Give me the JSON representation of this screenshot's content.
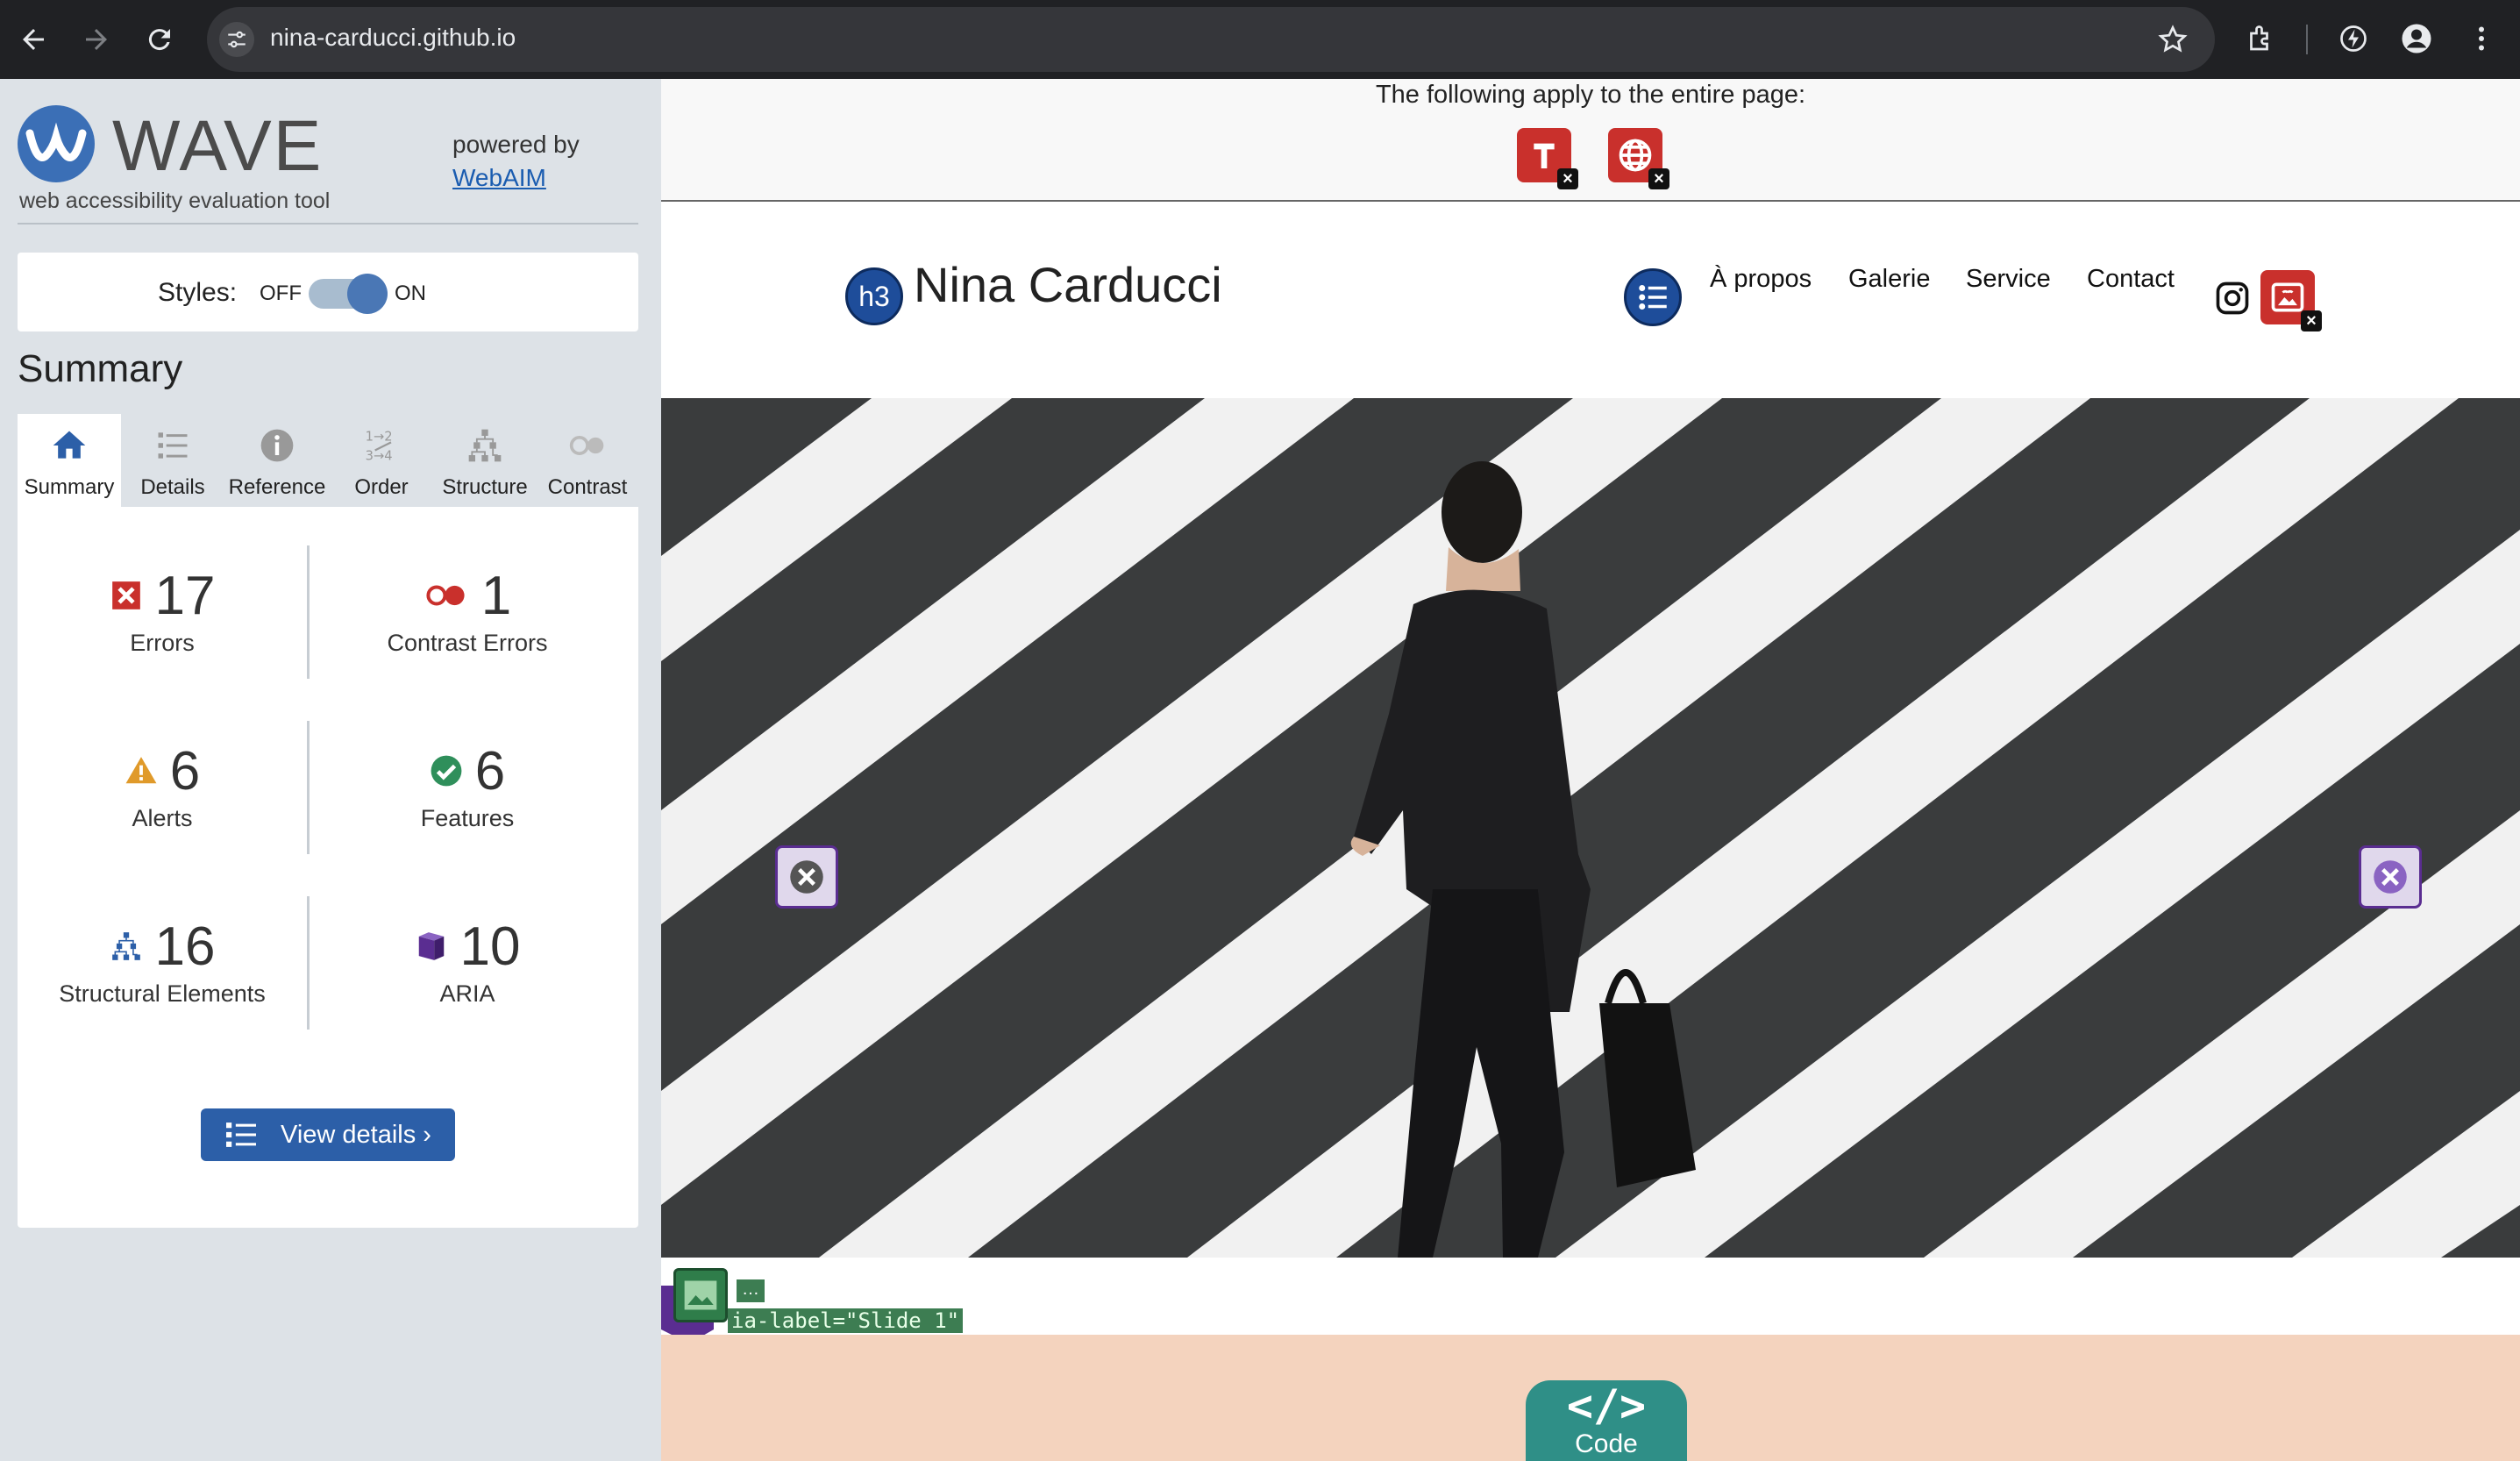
{
  "browser": {
    "url": "nina-carducci.github.io"
  },
  "wave": {
    "title": "WAVE",
    "subtitle": "web accessibility evaluation tool",
    "powered_by": "powered by",
    "powered_link": "WebAIM",
    "styles_label": "Styles:",
    "styles_off": "OFF",
    "styles_on": "ON",
    "summary_heading": "Summary",
    "tabs": [
      {
        "label": "Summary",
        "icon": "home-icon",
        "active": true
      },
      {
        "label": "Details",
        "icon": "list-icon",
        "active": false
      },
      {
        "label": "Reference",
        "icon": "info-icon",
        "active": false
      },
      {
        "label": "Order",
        "icon": "order-icon",
        "active": false
      },
      {
        "label": "Structure",
        "icon": "structure-icon",
        "active": false
      },
      {
        "label": "Contrast",
        "icon": "contrast-icon",
        "active": false
      }
    ],
    "stats": {
      "errors": {
        "count": "17",
        "label": "Errors"
      },
      "contrast_errors": {
        "count": "1",
        "label": "Contrast Errors"
      },
      "alerts": {
        "count": "6",
        "label": "Alerts"
      },
      "features": {
        "count": "6",
        "label": "Features"
      },
      "structural": {
        "count": "16",
        "label": "Structural Elements"
      },
      "aria": {
        "count": "10",
        "label": "ARIA"
      }
    },
    "view_details": "View details ›"
  },
  "page": {
    "banner_text": "The following apply to the entire page:",
    "heading_badge": "h3",
    "site_name": "Nina Carducci",
    "nav": [
      "À propos",
      "Galerie",
      "Service",
      "Contact"
    ],
    "aria_label_tag": "ia-label=\"Slide 1\"",
    "dots_tag": "…",
    "code_symbol": "</>",
    "code_label": "Code"
  },
  "colors": {
    "error": "#c9302c",
    "wave_blue": "#2c5fa8",
    "peach": "#f4d3be",
    "teal": "#2f8f87"
  }
}
